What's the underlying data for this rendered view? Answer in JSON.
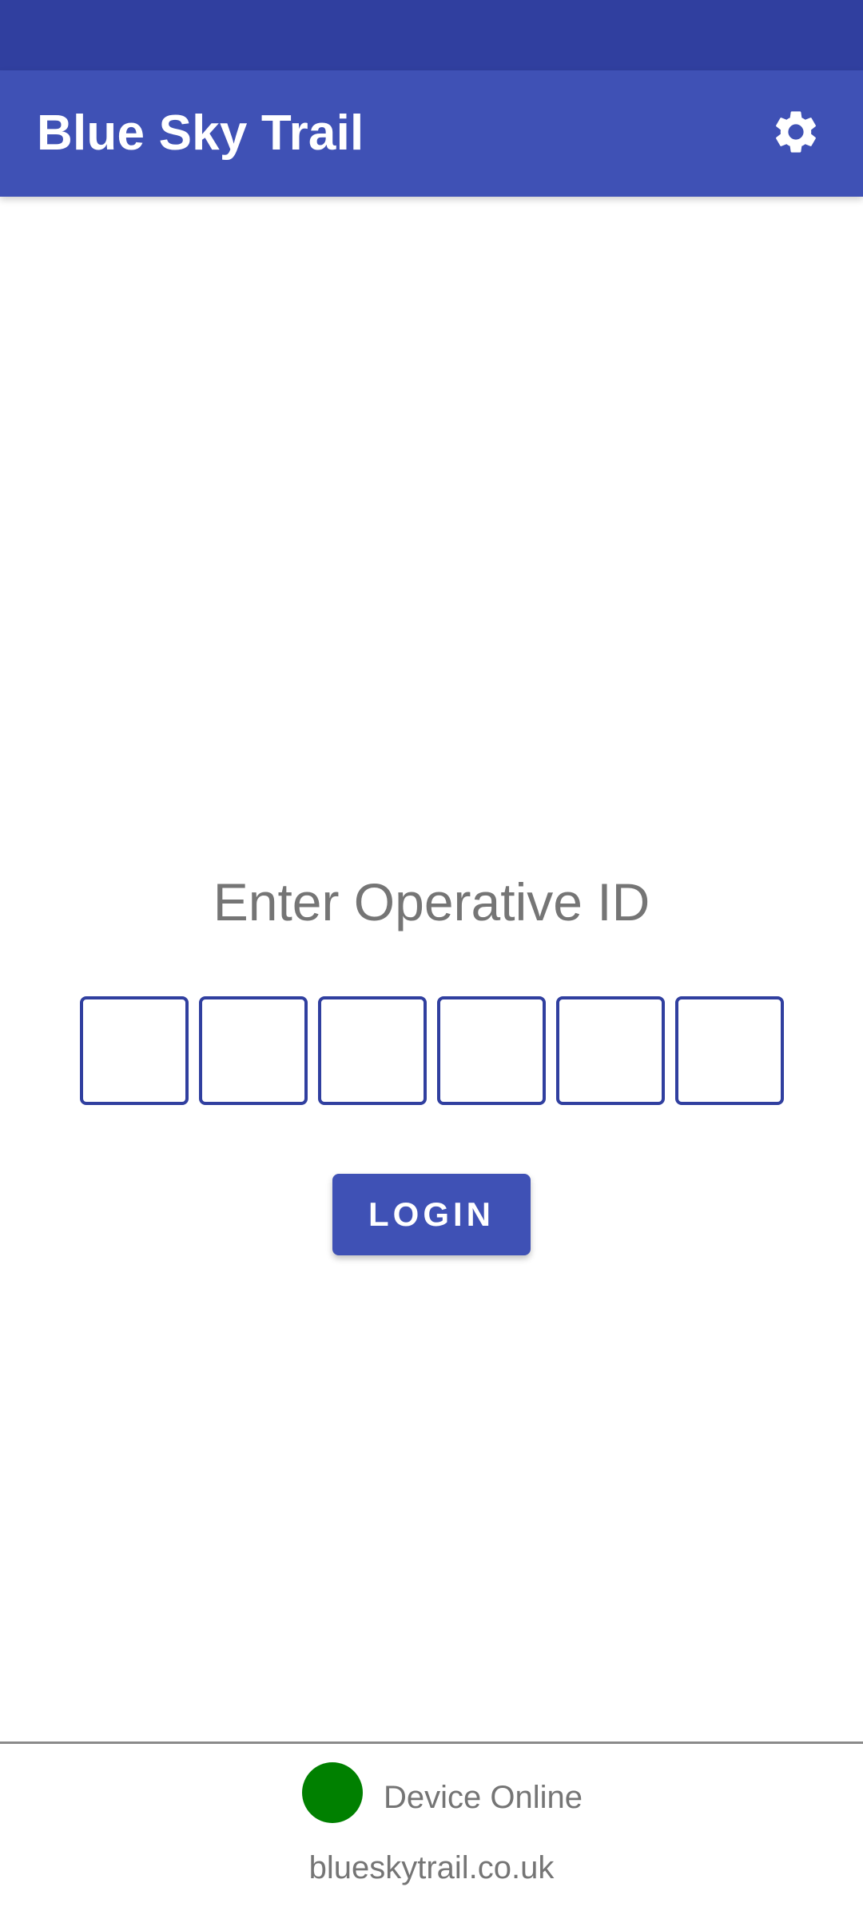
{
  "app": {
    "title": "Blue Sky Trail",
    "primary_color": "#3f51b5",
    "status_bar_color": "#303f9f",
    "settings_icon": "gear-icon"
  },
  "login": {
    "prompt": "Enter Operative ID",
    "pin_digits": [
      "",
      "",
      "",
      "",
      "",
      ""
    ],
    "login_label": "LOGIN"
  },
  "status": {
    "text": "Device Online",
    "indicator_color": "#008000",
    "indicator_icon": "status-dot"
  },
  "footer": {
    "url": "blueskytrail.co.uk"
  }
}
